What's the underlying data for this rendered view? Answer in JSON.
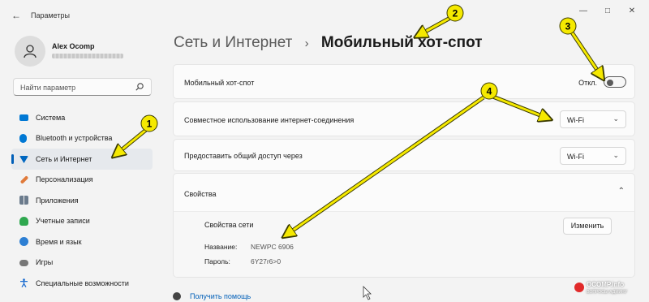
{
  "window": {
    "back_glyph": "←",
    "title": "Параметры",
    "controls": [
      "—",
      "□",
      "✕"
    ]
  },
  "user": {
    "name": "Alex Ocomp"
  },
  "search": {
    "placeholder": "Найти параметр"
  },
  "sidebar": {
    "items": [
      {
        "label": "Система",
        "icon": "system-icon",
        "color": "#0078d4"
      },
      {
        "label": "Bluetooth и устройства",
        "icon": "bluetooth-icon",
        "color": "#0078d4"
      },
      {
        "label": "Сеть и Интернет",
        "icon": "network-icon",
        "color": "#0067c0",
        "active": true
      },
      {
        "label": "Персонализация",
        "icon": "brush-icon",
        "color": "#e07a3a"
      },
      {
        "label": "Приложения",
        "icon": "apps-icon",
        "color": "#6b7b8c"
      },
      {
        "label": "Учетные записи",
        "icon": "accounts-icon",
        "color": "#2fa84f"
      },
      {
        "label": "Время и язык",
        "icon": "globe-icon",
        "color": "#2d7fd3"
      },
      {
        "label": "Игры",
        "icon": "gamepad-icon",
        "color": "#777777"
      },
      {
        "label": "Специальные возможности",
        "icon": "accessibility-icon",
        "color": "#1f6fd1"
      }
    ]
  },
  "breadcrumb": {
    "parent": "Сеть и Интернет",
    "separator": "›",
    "current": "Мобильный хот-спот"
  },
  "hotspot": {
    "label": "Мобильный хот-спот",
    "state": "Откл."
  },
  "sharing": {
    "label": "Совместное использование интернет-соединения",
    "value": "Wi-Fi"
  },
  "share_over": {
    "label": "Предоставить общий доступ через",
    "value": "Wi-Fi"
  },
  "properties": {
    "title": "Свойства",
    "net_props_label": "Свойства сети",
    "edit_label": "Изменить",
    "name_key": "Название:",
    "name_value": "NEWPC 6906",
    "password_key": "Пароль:",
    "password_value": "6Y27r6>0"
  },
  "help": {
    "label": "Получить помощь"
  },
  "annotations": {
    "badges": [
      "1",
      "2",
      "3",
      "4"
    ],
    "color": "#f5e900"
  },
  "watermark": {
    "text": "OCOMP.info",
    "sub": "ВОПРОСЫ АДМИНУ"
  }
}
